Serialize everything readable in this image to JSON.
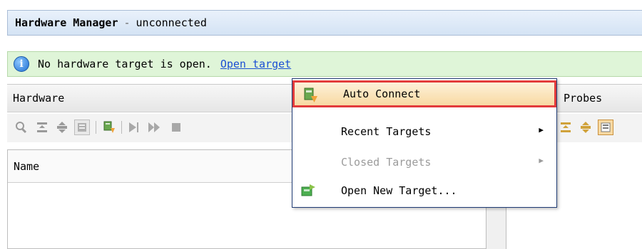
{
  "title": {
    "app": "Hardware Manager",
    "separator": "-",
    "status": "unconnected"
  },
  "info": {
    "icon": "info-icon",
    "message": "No hardware target is open.",
    "link": "Open target",
    "colors": {
      "link": "#1b4fd3",
      "background": "#dff5d8"
    }
  },
  "panels": {
    "hardware_title": "Hardware",
    "probes_title": "Probes"
  },
  "table": {
    "columns": [
      "Name"
    ]
  },
  "context_menu": {
    "items": [
      {
        "label": "Auto Connect",
        "state": "highlighted",
        "icon": "auto-connect-icon"
      },
      {
        "label": "Recent Targets",
        "state": "enabled",
        "submenu": true
      },
      {
        "label": "Closed Targets",
        "state": "disabled",
        "submenu": true
      },
      {
        "label": "Open New Target...",
        "state": "enabled",
        "icon": "open-new-target-icon"
      }
    ],
    "submenu_arrow": "▶",
    "colors": {
      "highlight_border": "#e23b3b",
      "highlight_fill": "#f8d9a2"
    }
  },
  "toolbar_icons": [
    "search-icon",
    "collapse-all-icon",
    "expand-all-icon",
    "properties-icon",
    "auto-connect-icon",
    "run-icon",
    "run-all-icon",
    "stop-icon"
  ],
  "probes_toolbar_icons": [
    "collapse-icon",
    "expand-icon",
    "properties-selected-icon"
  ]
}
